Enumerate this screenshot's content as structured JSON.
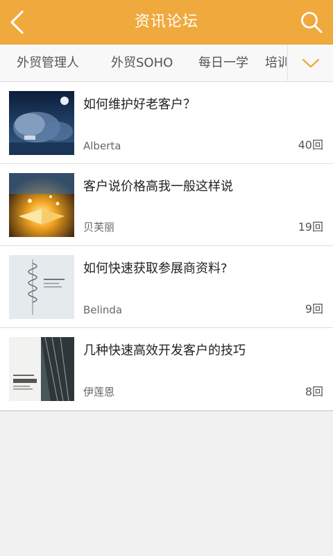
{
  "header": {
    "title": "资讯论坛",
    "back_icon": "chevron-left-icon",
    "search_icon": "search-icon"
  },
  "tabs": [
    {
      "label": "外贸管理人"
    },
    {
      "label": "外贸SOHO"
    },
    {
      "label": "每日一学"
    },
    {
      "label": "培训"
    }
  ],
  "tabs_more_icon": "chevron-down-icon",
  "posts": [
    {
      "title": "如何维护好老客户？",
      "author": "Alberta",
      "replies": "40回",
      "thumb": "night-tree-photo"
    },
    {
      "title": "客户说价格高我一般这样说",
      "author": "贝芙丽",
      "replies": "19回",
      "thumb": "glowing-book-photo"
    },
    {
      "title": "如何快速获取参展商资料?",
      "author": "Belinda",
      "replies": "9回",
      "thumb": "spiral-staircase-photo"
    },
    {
      "title": "几种快速高效开发客户的技巧",
      "author": "伊莲恩",
      "replies": "8回",
      "thumb": "building-cover-photo"
    }
  ],
  "colors": {
    "header_bg": "#f0a93d",
    "accent": "#f0a93d",
    "page_bg": "#f1f1f1"
  }
}
